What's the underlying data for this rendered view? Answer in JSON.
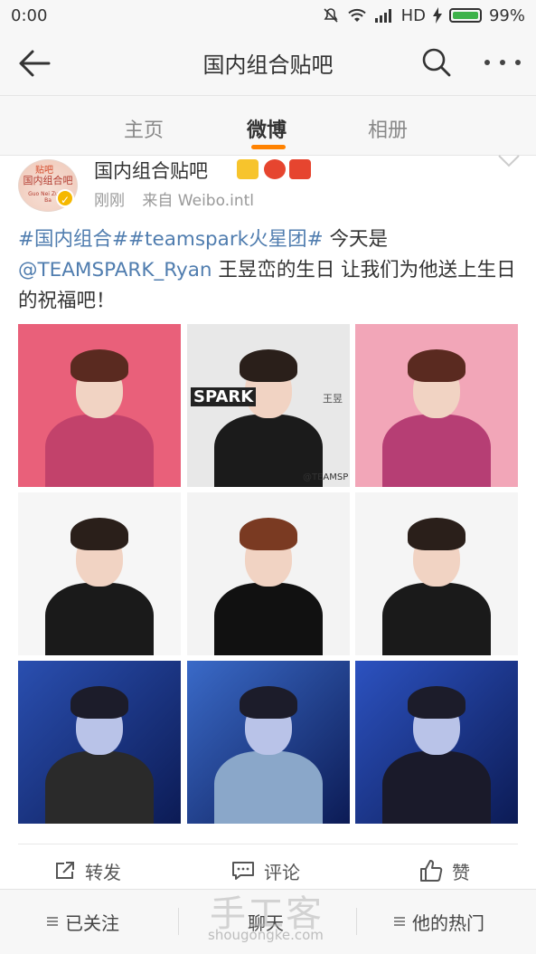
{
  "status_bar": {
    "time": "0:00",
    "network": "HD",
    "battery": "99%",
    "battery_level": 0.99,
    "icons": [
      "mute-icon",
      "wifi-icon",
      "signal-icon",
      "charging-icon",
      "battery-icon"
    ]
  },
  "nav": {
    "title": "国内组合贴吧",
    "back_icon": "arrow-left-icon",
    "search_icon": "search-icon",
    "more_icon": "more-dots-icon"
  },
  "tabs": [
    {
      "label": "主页",
      "active": false
    },
    {
      "label": "微博",
      "active": true
    },
    {
      "label": "相册",
      "active": false
    }
  ],
  "accent_color": "#ff8200",
  "link_color": "#507daf",
  "post": {
    "author": "国内组合贴吧",
    "avatar_text_top": "贴吧",
    "avatar_text": "国内组合吧",
    "avatar_text_small": "Guo Nei Zu He Ba",
    "time": "刚刚",
    "source": "来自 Weibo.intl",
    "text": {
      "topic1": "#国内组合#",
      "topic2": "#teamspark火星团#",
      "plain1": " 今天是",
      "mention": "@TEAMSPARK_Ryan",
      "plain2": " 王昱峦的生日 让我们为他送上生日的祝福吧！"
    },
    "photo_watermarks": {
      "logo": "SPARK",
      "side": "王昱",
      "handle": "@TEAMSP"
    },
    "photos": [
      {
        "desc": "pink-purple sweater, peace sign",
        "bg": "#e9607a",
        "shirt": "#c2426b",
        "hair": "#5a2a20"
      },
      {
        "desc": "black suit seated, SPARK logo",
        "bg": "#e8e8e8",
        "shirt": "#1b1b1b",
        "hair": "#2a1f1a"
      },
      {
        "desc": "pink-purple sweater, smiling",
        "bg": "#f2a6b8",
        "shirt": "#b63e74",
        "hair": "#5a2a20"
      },
      {
        "desc": "full body black jacket",
        "bg": "#f6f6f6",
        "shirt": "#1a1a1a",
        "hair": "#2a1f1a"
      },
      {
        "desc": "black hoodie with chain",
        "bg": "#f3f3f3",
        "shirt": "#111111",
        "hair": "#7a3a22"
      },
      {
        "desc": "profile black jacket",
        "bg": "#f5f5f5",
        "shirt": "#1a1a1a",
        "hair": "#2a1f1a"
      },
      {
        "desc": "stage black sequin blazer",
        "bg": "#2a4fb0",
        "shirt": "#2a2a2a",
        "hair": "#1c1c2a"
      },
      {
        "desc": "stage silver jacket",
        "bg": "#3a6ac8",
        "shirt": "#8aa7c9",
        "hair": "#1c1c2a"
      },
      {
        "desc": "stage close-up",
        "bg": "#2c52c0",
        "shirt": "#1a1a2a",
        "hair": "#1c1c2a"
      }
    ],
    "actions": [
      {
        "label": "转发",
        "icon": "share-icon"
      },
      {
        "label": "评论",
        "icon": "comment-icon"
      },
      {
        "label": "赞",
        "icon": "like-icon"
      }
    ]
  },
  "bottom_bar": [
    {
      "label": "已关注",
      "icon": "menu-icon"
    },
    {
      "label": "聊天",
      "icon": ""
    },
    {
      "label": "他的热门",
      "icon": "menu-icon"
    }
  ],
  "watermark": {
    "text": "手工客",
    "url": "shougongke.com"
  }
}
